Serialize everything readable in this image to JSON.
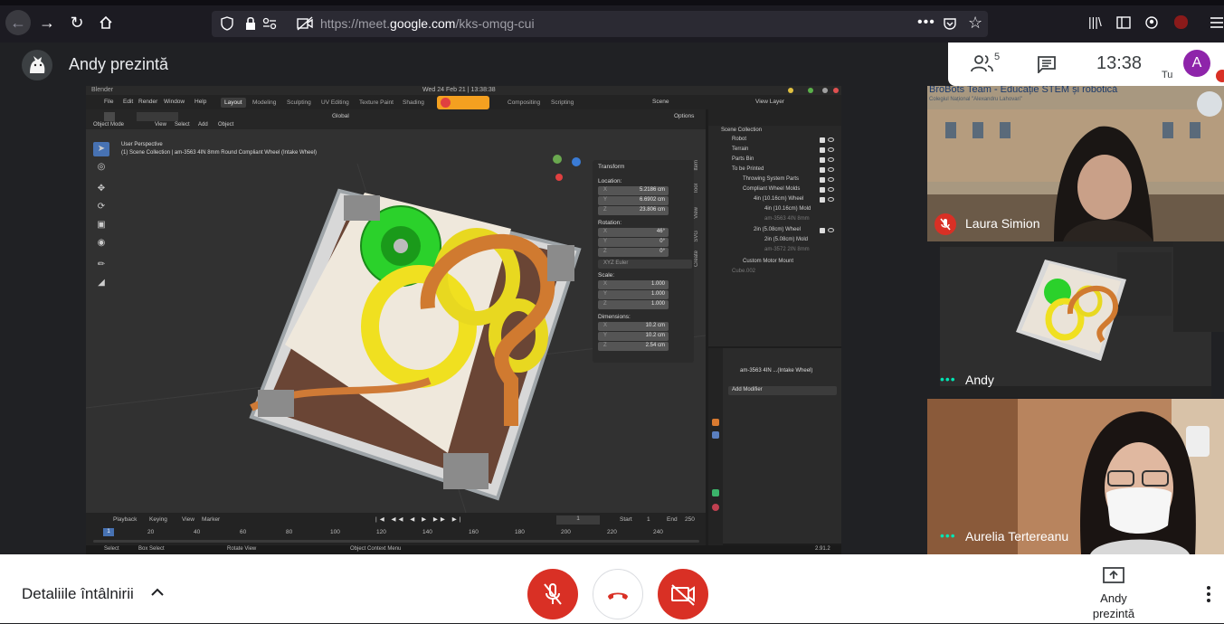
{
  "browser": {
    "url_prefix": "https://meet.",
    "url_domain": "google.com",
    "url_path": "/kks-omqg-cui",
    "more_label": "•••"
  },
  "meet": {
    "presenter_title": "Andy prezintă",
    "participant_count": "5",
    "clock": "13:38",
    "self_initial": "A",
    "self_label": "Tu"
  },
  "blender": {
    "app_name": "Blender",
    "datetime": "Wed 24 Feb 21 | 13:38:38",
    "menus": [
      "File",
      "Edit",
      "Render",
      "Window",
      "Help"
    ],
    "workspace_tabs": [
      "Layout",
      "Modeling",
      "Sculpting",
      "UV Editing",
      "Texture Paint",
      "Shading",
      "Compositing",
      "Scripting"
    ],
    "scene": "Scene",
    "view_layer": "View Layer",
    "mode": "Object Mode",
    "view_menus": [
      "View",
      "Select",
      "Add",
      "Object"
    ],
    "orientation": "Global",
    "options": "Options",
    "viewport_label": "User Perspective",
    "collection_label": "(1) Scene Collection | am-3563 4IN 8mm Round Compliant Wheel (Intake Wheel)",
    "transform": {
      "title": "Transform",
      "location_label": "Location:",
      "location": [
        {
          "axis": "X",
          "value": "5.2186 cm"
        },
        {
          "axis": "Y",
          "value": "6.6902 cm"
        },
        {
          "axis": "Z",
          "value": "23.806 cm"
        }
      ],
      "rotation_label": "Rotation:",
      "rotation": [
        {
          "axis": "X",
          "value": "46°"
        },
        {
          "axis": "Y",
          "value": "0°"
        },
        {
          "axis": "Z",
          "value": "0°"
        }
      ],
      "rotation_mode": "XYZ Euler",
      "scale_label": "Scale:",
      "scale": [
        {
          "axis": "X",
          "value": "1.000"
        },
        {
          "axis": "Y",
          "value": "1.000"
        },
        {
          "axis": "Z",
          "value": "1.000"
        }
      ],
      "dimensions_label": "Dimensions:",
      "dimensions": [
        {
          "axis": "X",
          "value": "10.2 cm"
        },
        {
          "axis": "Y",
          "value": "10.2 cm"
        },
        {
          "axis": "Z",
          "value": "2.54 cm"
        }
      ]
    },
    "side_tabs": [
      "Item",
      "Tool",
      "View",
      "SVG",
      "Create"
    ],
    "outliner": {
      "root": "Scene Collection",
      "items": [
        {
          "label": "Robot",
          "dim": false
        },
        {
          "label": "Terrain",
          "dim": false
        },
        {
          "label": "Parts Bin",
          "dim": false
        },
        {
          "label": "To be Printed",
          "dim": false
        },
        {
          "label": "Throwing System Parts",
          "dim": false
        },
        {
          "label": "Compliant Wheel Molds",
          "dim": false
        },
        {
          "label": "4in (10.16cm) Wheel",
          "dim": false
        },
        {
          "label": "4in (10.16cm) Mold",
          "dim": false
        },
        {
          "label": "am-3563 4IN 8mm",
          "dim": true
        },
        {
          "label": "2in (5.08cm) Wheel",
          "dim": false
        },
        {
          "label": "2in (5.08cm) Mold",
          "dim": false
        },
        {
          "label": "am-3572 2IN 8mm",
          "dim": true
        },
        {
          "label": "Custom Motor Mount",
          "dim": false
        },
        {
          "label": "Cube.002",
          "dim": true
        }
      ]
    },
    "properties": {
      "object_name": "am-3563 4IN ...(Intake Wheel)",
      "add_modifier": "Add Modifier"
    },
    "timeline": {
      "menus": [
        "Playback",
        "Keying",
        "View",
        "Marker"
      ],
      "current_frame": "1",
      "start_label": "Start",
      "start": "1",
      "end_label": "End",
      "end": "250",
      "ticks": [
        "1",
        "20",
        "40",
        "60",
        "80",
        "100",
        "120",
        "140",
        "160",
        "180",
        "200",
        "220",
        "240"
      ]
    },
    "status": {
      "select": "Select",
      "box_select": "Box Select",
      "rotate_view": "Rotate View",
      "context_menu": "Object Context Menu",
      "version": "2.91.2"
    }
  },
  "participants": {
    "laura": {
      "name": "Laura Simion",
      "banner": "BroBots Team - Educație STEM și robotică",
      "banner_sub": "Colegiul Național \"Alexandru Lahovari\""
    },
    "andy": {
      "name": "Andy"
    },
    "aurelia": {
      "name": "Aurelia Tertereanu"
    },
    "dots": "•••"
  },
  "controls": {
    "meeting_details": "Detaliile întâlnirii",
    "present_line1": "Andy",
    "present_line2": "prezintă"
  },
  "colors": {
    "accent_red": "#d93025",
    "self_avatar": "#8e24aa",
    "speaking_dots": "#00e5b3"
  }
}
